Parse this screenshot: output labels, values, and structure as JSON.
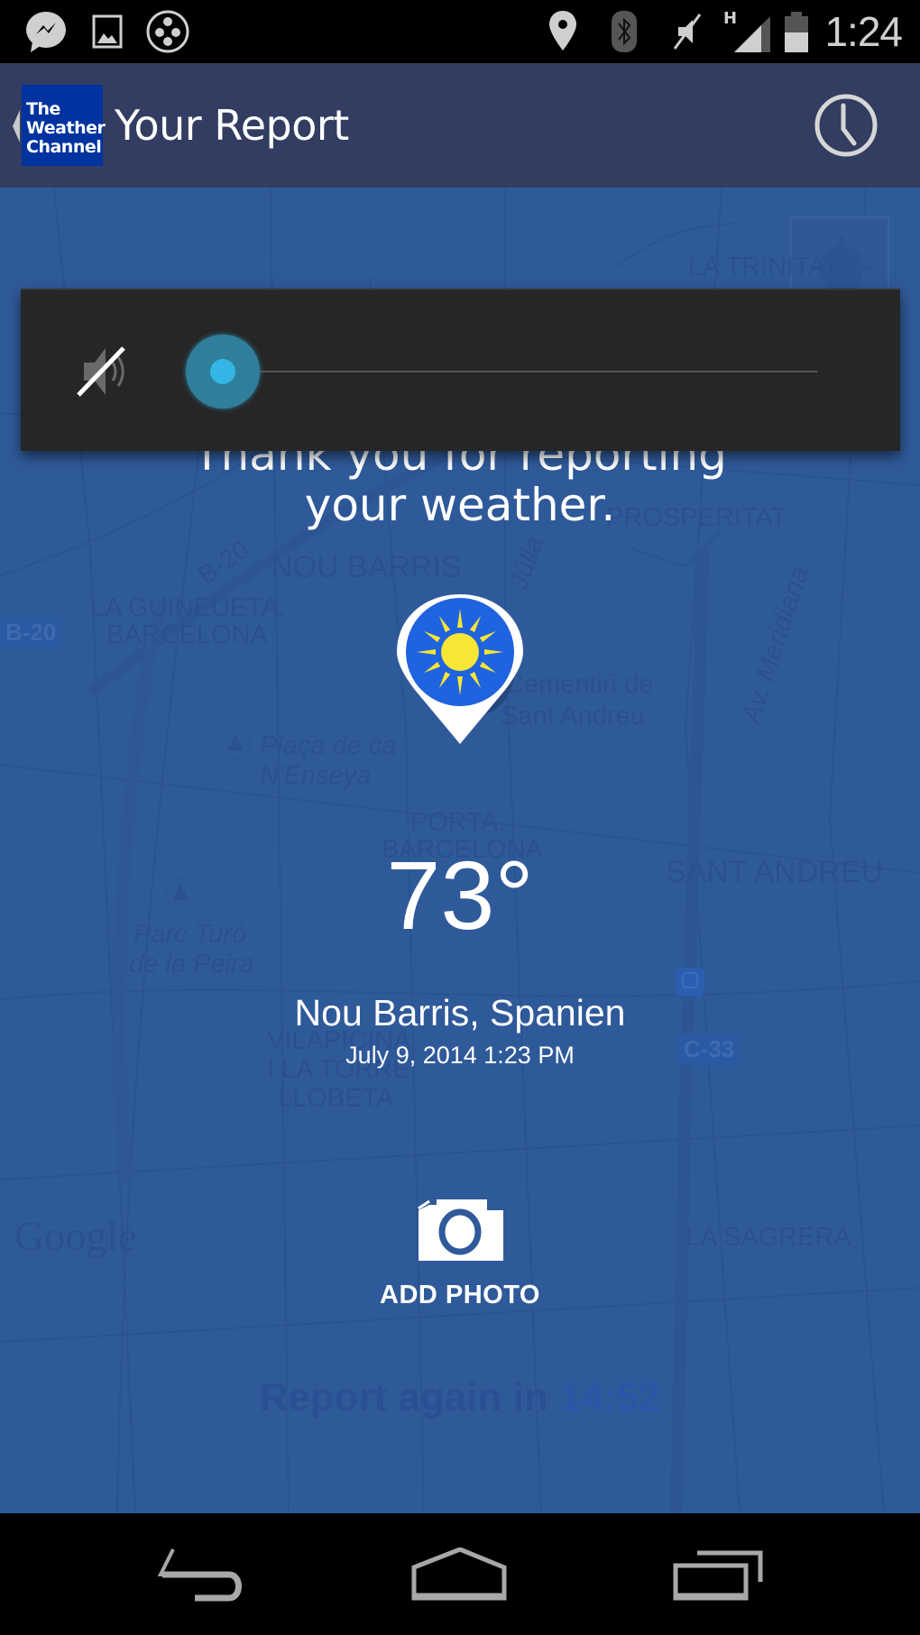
{
  "status_bar": {
    "time": "1:24",
    "network_type": "H",
    "notification_icons": [
      "messenger-icon",
      "gallery-icon",
      "hangouts-circle-icon"
    ],
    "system_icons": [
      "location-icon",
      "bluetooth-icon",
      "vibrate-off-icon",
      "signal-icon",
      "battery-icon"
    ]
  },
  "app_bar": {
    "logo_lines": [
      "The",
      "Weather",
      "Channel"
    ],
    "title": "Your Report",
    "history_icon": "clock-icon"
  },
  "volume_overlay": {
    "icon": "volume-muted-icon",
    "level_percent": 0
  },
  "report": {
    "thank_you_line1": "Thank you for reporting",
    "thank_you_line2": "your weather.",
    "condition_icon": "sunny-icon",
    "temperature": "73°",
    "location": "Nou Barris, Spanien",
    "datetime": "July 9, 2014 1:23 PM",
    "add_photo_label": "ADD PHOTO",
    "report_again_prefix": "Report again in",
    "report_again_countdown": "14:52"
  },
  "map": {
    "labels": [
      {
        "text": "LA TRINITAT",
        "style": "normal"
      },
      {
        "text": "PROSPERITAT",
        "style": "normal"
      },
      {
        "text": "NOU BARRIS",
        "style": "normal"
      },
      {
        "text": "LA GUINEUETA,",
        "style": "normal"
      },
      {
        "text": "BARCELONA",
        "style": "normal"
      },
      {
        "text": "Júlia",
        "style": "italic"
      },
      {
        "text": "Av. Meridiana",
        "style": "italic"
      },
      {
        "text": "Cementiri de",
        "style": "normal"
      },
      {
        "text": "Sant Andreu",
        "style": "normal"
      },
      {
        "text": "Plaça de ca",
        "style": "italic"
      },
      {
        "text": "N'Enseya",
        "style": "italic"
      },
      {
        "text": "PORTA,",
        "style": "normal"
      },
      {
        "text": "BARCELONA",
        "style": "normal"
      },
      {
        "text": "SANT ANDREU",
        "style": "normal"
      },
      {
        "text": "Parc Turó",
        "style": "italic"
      },
      {
        "text": "de la Peira",
        "style": "italic"
      },
      {
        "text": "VILAPICINA",
        "style": "normal"
      },
      {
        "text": "I LA TORRE",
        "style": "normal"
      },
      {
        "text": "LLOBETA",
        "style": "normal"
      },
      {
        "text": "LA SAGRERA",
        "style": "normal"
      },
      {
        "text": "Google",
        "style": "normal"
      }
    ],
    "route_badges": [
      "B-20",
      "B-20",
      "C-33"
    ]
  },
  "nav_bar": {
    "back": "back-icon",
    "home": "home-icon",
    "recents": "recents-icon"
  },
  "colors": {
    "app_bar": "#323d61",
    "map_overlay": "#2f5a9a",
    "slider_accent": "#33b5e5",
    "sun": "#f9e534",
    "pin_fill": "#1f63e0"
  }
}
